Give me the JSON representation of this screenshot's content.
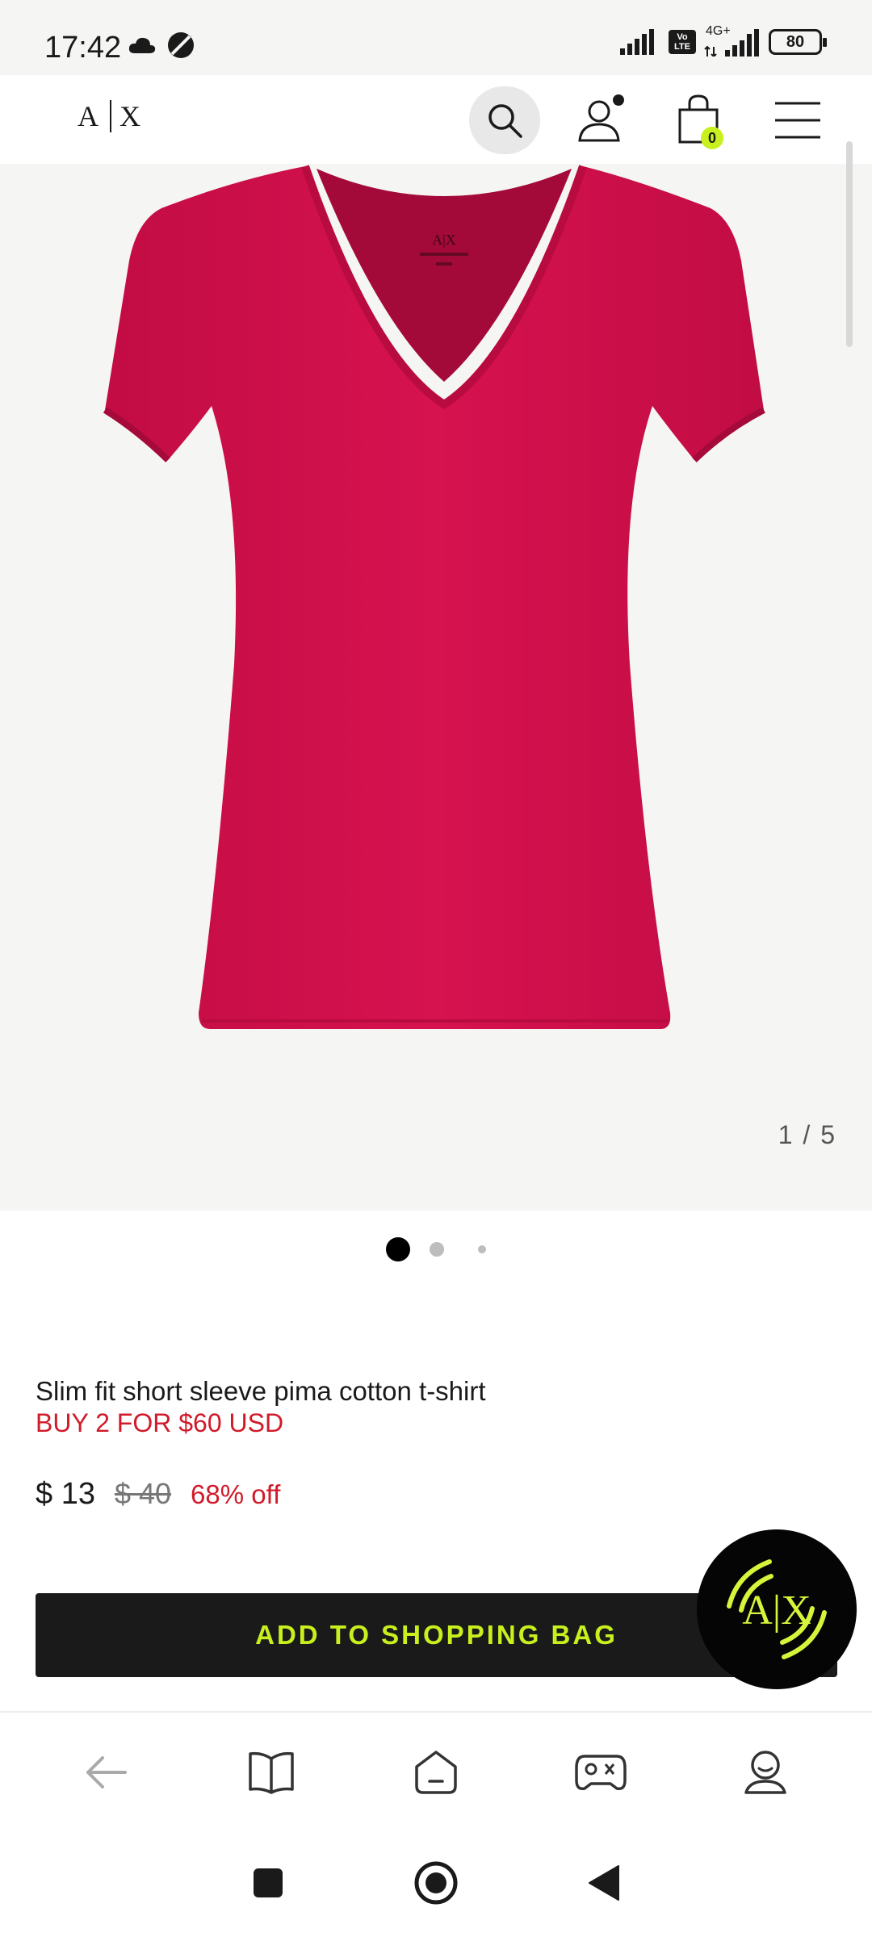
{
  "status_bar": {
    "time": "17:42",
    "battery": "80",
    "network": "4G+",
    "volte": "Vo LTE"
  },
  "header": {
    "logo": "A|X",
    "cart_count": "0"
  },
  "gallery": {
    "counter": "1 / 5",
    "product_color": "#d0104c",
    "total_images": 5,
    "current_index": 1
  },
  "product": {
    "title": "Slim fit short sleeve pima cotton t-shirt",
    "promo": "BUY 2 FOR $60 USD",
    "price_now": "$ 13",
    "price_old": "$ 40",
    "discount": "68% off"
  },
  "actions": {
    "add_to_bag": "ADD TO SHOPPING BAG"
  },
  "chat": {
    "logo": "A|X"
  },
  "colors": {
    "accent": "#c8f01e",
    "sale_red": "#d11a2a",
    "dark": "#1a1a1a"
  },
  "bottom_nav": [
    "back-icon",
    "book-icon",
    "home-icon",
    "gamepad-icon",
    "profile-icon"
  ],
  "system_nav": [
    "recents-icon",
    "home-icon",
    "back-icon"
  ]
}
